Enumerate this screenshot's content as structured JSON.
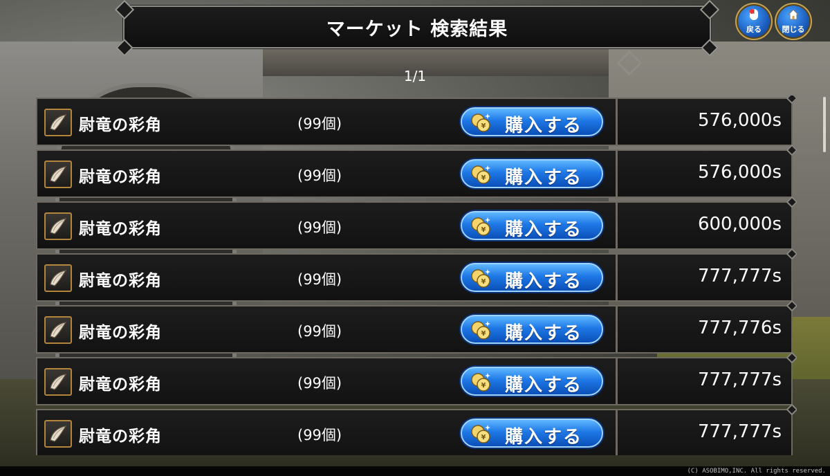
{
  "header": {
    "title": "マーケット 検索結果"
  },
  "nav": {
    "back_label": "戻る",
    "close_label": "閉じる",
    "back_icon": "mouse-icon",
    "close_icon": "house-icon"
  },
  "pagination": {
    "text": "1/1"
  },
  "listings": [
    {
      "name": "尉竜の彩角",
      "quantity": "(99個)",
      "buy_label": "購入する",
      "price": "576,000s"
    },
    {
      "name": "尉竜の彩角",
      "quantity": "(99個)",
      "buy_label": "購入する",
      "price": "576,000s"
    },
    {
      "name": "尉竜の彩角",
      "quantity": "(99個)",
      "buy_label": "購入する",
      "price": "600,000s"
    },
    {
      "name": "尉竜の彩角",
      "quantity": "(99個)",
      "buy_label": "購入する",
      "price": "777,777s"
    },
    {
      "name": "尉竜の彩角",
      "quantity": "(99個)",
      "buy_label": "購入する",
      "price": "777,776s"
    },
    {
      "name": "尉竜の彩角",
      "quantity": "(99個)",
      "buy_label": "購入する",
      "price": "777,777s"
    },
    {
      "name": "尉竜の彩角",
      "quantity": "(99個)",
      "buy_label": "購入する",
      "price": "777,777s"
    }
  ],
  "footer": {
    "copyright": "(C) ASOBIMO,INC. All rights reserved."
  },
  "colors": {
    "buy_button": "#1e78e6",
    "panel_bg": "#151515",
    "frame": "#6e6a62",
    "icon_border": "#b3863c"
  }
}
